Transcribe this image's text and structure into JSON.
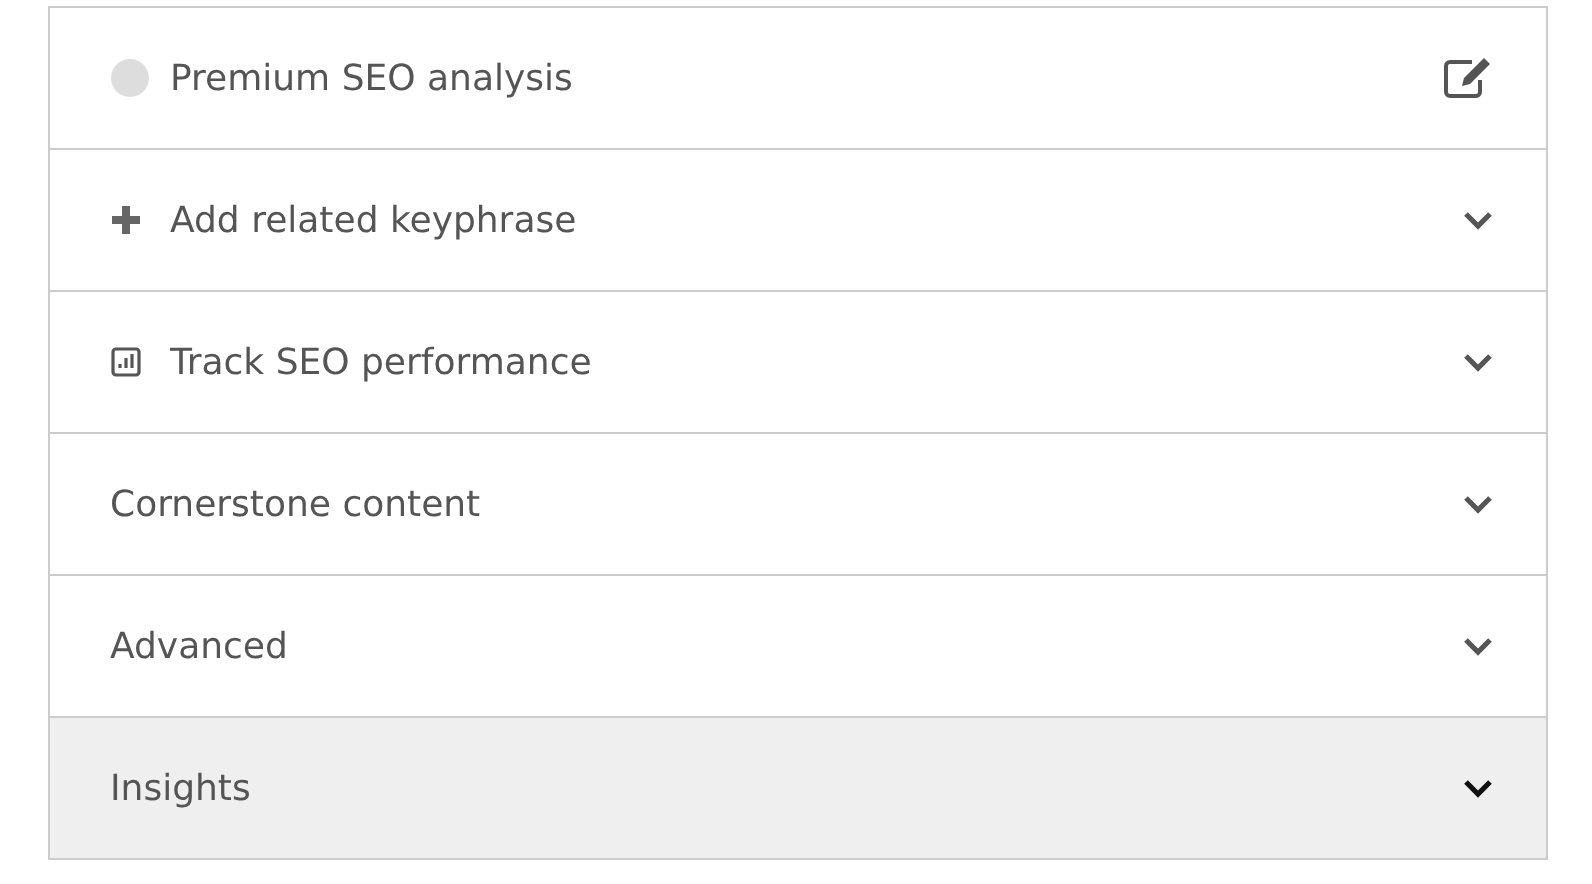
{
  "sections": [
    {
      "title": "Premium SEO analysis",
      "kind": "analysis",
      "highlighted": false
    },
    {
      "title": "Add related keyphrase",
      "kind": "add",
      "highlighted": false
    },
    {
      "title": "Track SEO performance",
      "kind": "track",
      "highlighted": false
    },
    {
      "title": "Cornerstone content",
      "kind": "plain",
      "highlighted": false
    },
    {
      "title": "Advanced",
      "kind": "plain",
      "highlighted": false
    },
    {
      "title": "Insights",
      "kind": "plain",
      "highlighted": true
    }
  ]
}
